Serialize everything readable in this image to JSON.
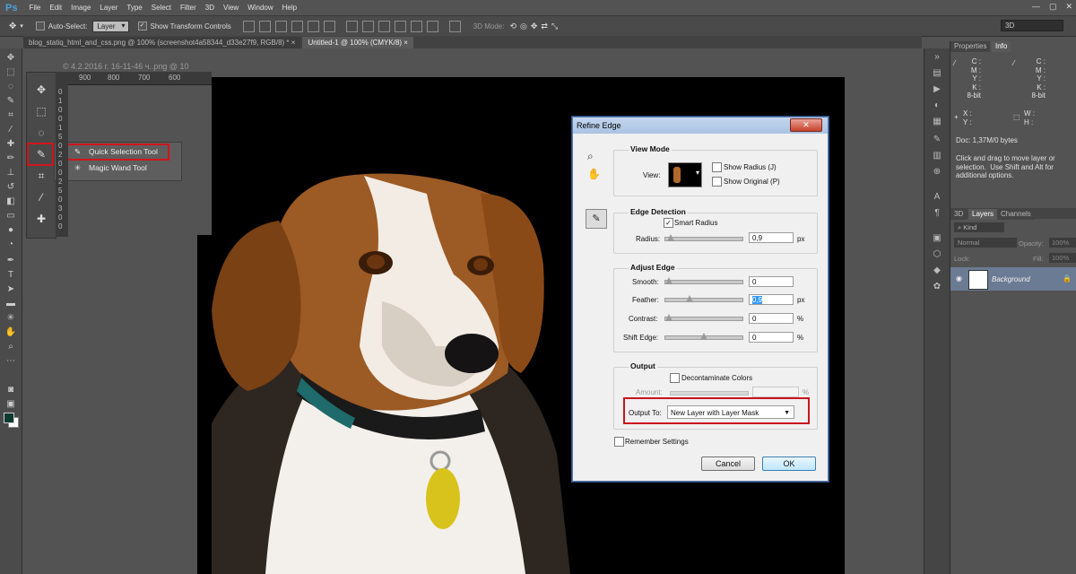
{
  "app": {
    "logo": "Ps"
  },
  "menu": [
    "File",
    "Edit",
    "Image",
    "Layer",
    "Type",
    "Select",
    "Filter",
    "3D",
    "View",
    "Window",
    "Help"
  ],
  "window_controls": [
    "—",
    "▢",
    "✕"
  ],
  "options_bar": {
    "auto_select_label": "Auto-Select:",
    "layer_value": "Layer",
    "show_transform_label": "Show Transform Controls",
    "mode3d_label": "3D Mode:",
    "workspace": "3D"
  },
  "tabs": [
    {
      "label": "blog_statiq_html_and_css.png @ 100% (screenshot4a58344_d33e27f9, RGB/8) *",
      "close": "×"
    },
    {
      "label": "Untitled-1 @ 100% (CMYK/8)",
      "close": "×"
    }
  ],
  "canvas_crumb": "© 4.2.2016 г. 16-11-46 ч..png @ 10",
  "ruler": {
    "top": [
      "900",
      "800",
      "700",
      "600"
    ],
    "left": [
      "0",
      "1",
      "0",
      "0",
      "1",
      "5",
      "0",
      "2",
      "0",
      "0",
      "2",
      "5",
      "0",
      "3",
      "0",
      "0"
    ]
  },
  "flyout": {
    "items": [
      {
        "label": "Quick Selection Tool",
        "icon": "quick-selection-icon"
      },
      {
        "label": "Magic Wand Tool",
        "icon": "magic-wand-icon"
      }
    ]
  },
  "dialog": {
    "title": "Refine Edge",
    "close": "✕",
    "view_mode": {
      "title": "View Mode",
      "view_label": "View:",
      "show_radius": "Show Radius (J)",
      "show_original": "Show Original (P)"
    },
    "edge_detection": {
      "title": "Edge Detection",
      "smart_radius": "Smart Radius",
      "radius_label": "Radius:",
      "radius_value": "0,9",
      "radius_unit": "px",
      "radius_level": 0.02
    },
    "adjust_edge": {
      "title": "Adjust Edge",
      "rows": [
        {
          "label": "Smooth:",
          "value": "0",
          "unit": "",
          "level": 0.0,
          "selected": false
        },
        {
          "label": "Feather:",
          "value": "0,9",
          "unit": "px",
          "level": 0.3,
          "selected": true
        },
        {
          "label": "Contrast:",
          "value": "0",
          "unit": "%",
          "level": 0.0,
          "selected": false
        },
        {
          "label": "Shift Edge:",
          "value": "0",
          "unit": "%",
          "level": 0.5,
          "selected": false
        }
      ]
    },
    "output": {
      "title": "Output",
      "decontaminate": "Decontaminate Colors",
      "amount_label": "Amount:",
      "amount_unit": "%",
      "output_to_label": "Output To:",
      "output_to_value": "New Layer with Layer Mask"
    },
    "remember": "Remember Settings",
    "cancel": "Cancel",
    "ok": "OK"
  },
  "panels": {
    "top_tabs": [
      "Properties",
      "Info"
    ],
    "info": {
      "cmyk_left": "C :\nM :\nY :\nK :\n8-bit",
      "cmyk_right": "C :\nM :\nY :\nK :\n8-bit",
      "xy": "X :\nY :",
      "wh": "W :\nH :",
      "doc": "Doc: 1,37M/0 bytes",
      "hint": "Click and drag to move layer or\nselection.  Use Shift and Alt for\nadditional options."
    },
    "layer_tabs": [
      "3D",
      "Layers",
      "Channels"
    ],
    "layers": {
      "kind": "Kind",
      "mode": "Normal",
      "opacity_label": "Opacity:",
      "opacity_value": "100%",
      "lock_label": "Lock:",
      "fill_label": "Fill:",
      "fill_value": "100%",
      "background_name": "Background"
    }
  },
  "colors": {
    "foreground": "#0f3a32",
    "background": "#ffffff",
    "highlight": "#d1141c",
    "selected_layer": "#6b7b94"
  }
}
